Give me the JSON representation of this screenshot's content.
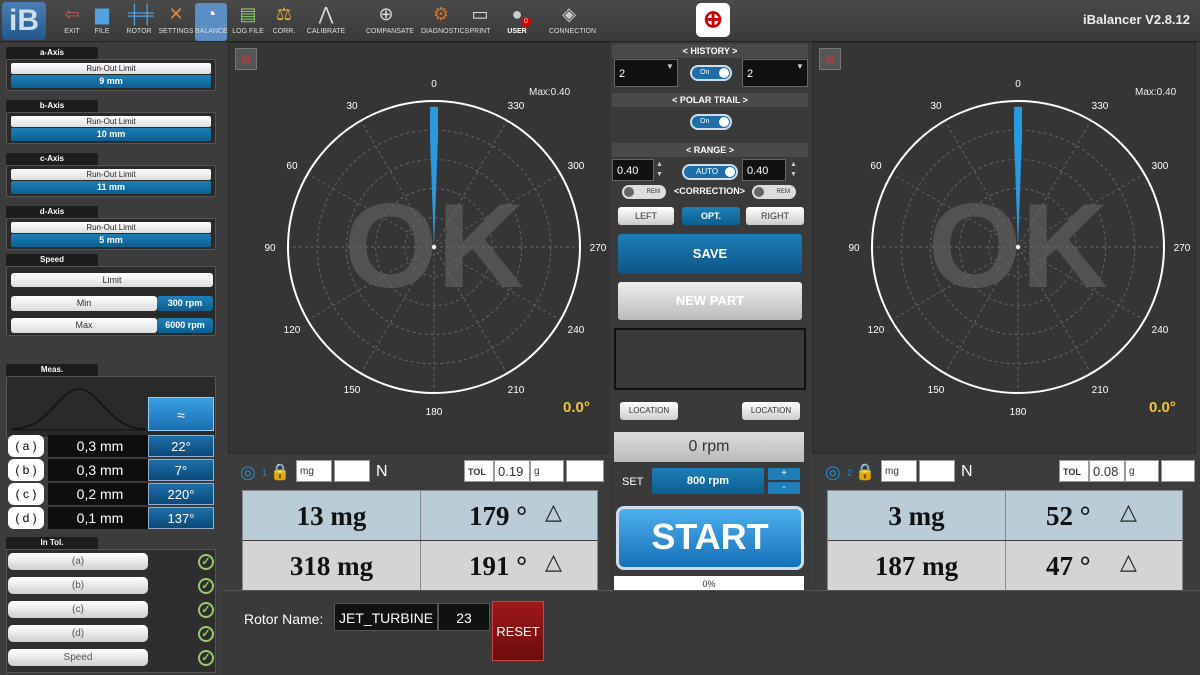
{
  "toolbar": {
    "items": [
      {
        "label": "EXIT",
        "icon": "exit-icon"
      },
      {
        "label": "FILE",
        "icon": "folder-icon"
      },
      {
        "label": "ROTOR",
        "icon": "rotor-icon"
      },
      {
        "label": "SETTINGS",
        "icon": "tools-icon"
      },
      {
        "label": "BALANCE",
        "icon": "gauge-icon"
      },
      {
        "label": "LOG FILE",
        "icon": "log-file-icon"
      },
      {
        "label": "CORR.",
        "icon": "scale-icon"
      },
      {
        "label": "CALIBRATE",
        "icon": "compass-icon"
      },
      {
        "label": "COMPANSATE",
        "icon": "crosshair-icon"
      },
      {
        "label": "DIAGNOSTICS",
        "icon": "diagnostics-icon"
      },
      {
        "label": "PRINT",
        "icon": "printer-icon"
      },
      {
        "label": "USER",
        "icon": "user-icon",
        "badge": "0"
      },
      {
        "label": "CONNECTION",
        "icon": "connection-icon"
      }
    ],
    "logo_text": "iB",
    "version": "iBalancer V2.8.12"
  },
  "left": {
    "axes": [
      {
        "header": "a-Axis",
        "limit_label": "Run-Out Limit",
        "limit_value": "9 mm"
      },
      {
        "header": "b-Axis",
        "limit_label": "Run-Out Limit",
        "limit_value": "10 mm"
      },
      {
        "header": "c-Axis",
        "limit_label": "Run-Out Limit",
        "limit_value": "11 mm"
      },
      {
        "header": "d-Axis",
        "limit_label": "Run-Out Limit",
        "limit_value": "5 mm"
      }
    ],
    "speed": {
      "header": "Speed",
      "limit_label": "Limit",
      "min_label": "Min",
      "min_value": "300 rpm",
      "max_label": "Max",
      "max_value": "6000 rpm"
    },
    "meas": {
      "header": "Meas.",
      "approx": "≈",
      "rows": [
        {
          "label": "( a )",
          "value": "0,3 mm",
          "angle": "22°"
        },
        {
          "label": "( b )",
          "value": "0,3 mm",
          "angle": "7°"
        },
        {
          "label": "( c )",
          "value": "0,2 mm",
          "angle": "220°"
        },
        {
          "label": "( d )",
          "value": "0,1 mm",
          "angle": "137°"
        }
      ]
    },
    "intol": {
      "header": "In Tol.",
      "items": [
        "(a)",
        "(b)",
        "(c)",
        "(d)",
        "Speed"
      ]
    }
  },
  "polar_left": {
    "max": "Max:0.40",
    "angle": "0.0°",
    "status": "OK",
    "ticks": [
      "0",
      "30",
      "60",
      "90",
      "120",
      "150",
      "180",
      "210",
      "240",
      "270",
      "300",
      "330"
    ]
  },
  "polar_right": {
    "max": "Max:0.40",
    "angle": "0.0°",
    "status": "OK",
    "ticks": [
      "0",
      "30",
      "60",
      "90",
      "120",
      "150",
      "180",
      "210",
      "240",
      "270",
      "300",
      "330"
    ]
  },
  "mid": {
    "history_hdr": "<  HISTORY  >",
    "history_left": "2",
    "history_toggle": "On",
    "history_right": "2",
    "polar_trail_hdr": "<  POLAR TRAIL  >",
    "polar_trail_toggle": "On",
    "range_hdr": "<  RANGE  >",
    "range_left": "0.40",
    "range_toggle": "AUTO",
    "range_right": "0.40",
    "rem_left": "REM",
    "correction": "<CORRECTION>",
    "rem_right": "REM",
    "left_btn": "LEFT",
    "opt_btn": "OPT.",
    "right_btn": "RIGHT",
    "save": "SAVE",
    "new_part": "NEW PART",
    "location_left": "LOCATION",
    "location_right": "LOCATION",
    "rpm": "0 rpm",
    "set_label": "SET",
    "set_value": "800 rpm",
    "plus": "+",
    "minus": "-",
    "start": "START",
    "progress": "0%"
  },
  "plane1": {
    "id": "1",
    "unit": "mg",
    "N": "N",
    "tol_label": "TOL",
    "tol_value": "0.19",
    "tol_unit": "g",
    "rows": [
      {
        "mass": "13 mg",
        "angle": "179 °"
      },
      {
        "mass": "318 mg",
        "angle": "191 °"
      }
    ]
  },
  "plane2": {
    "id": "2",
    "unit": "mg",
    "N": "N",
    "tol_label": "TOL",
    "tol_value": "0.08",
    "tol_unit": "g",
    "rows": [
      {
        "mass": "3 mg",
        "angle": "52 °"
      },
      {
        "mass": "187 mg",
        "angle": "47 °"
      }
    ]
  },
  "rotor": {
    "name_label": "Rotor Name:",
    "name_value": "JET_TURBINE",
    "number": "23",
    "reset": "RESET"
  },
  "colors": {
    "accent": "#1e7fb8",
    "ok_yellow": "#f4c430",
    "reset_red": "#8b1010",
    "table_blue": "#b8cdd8",
    "table_gray": "#d4d4d4"
  }
}
